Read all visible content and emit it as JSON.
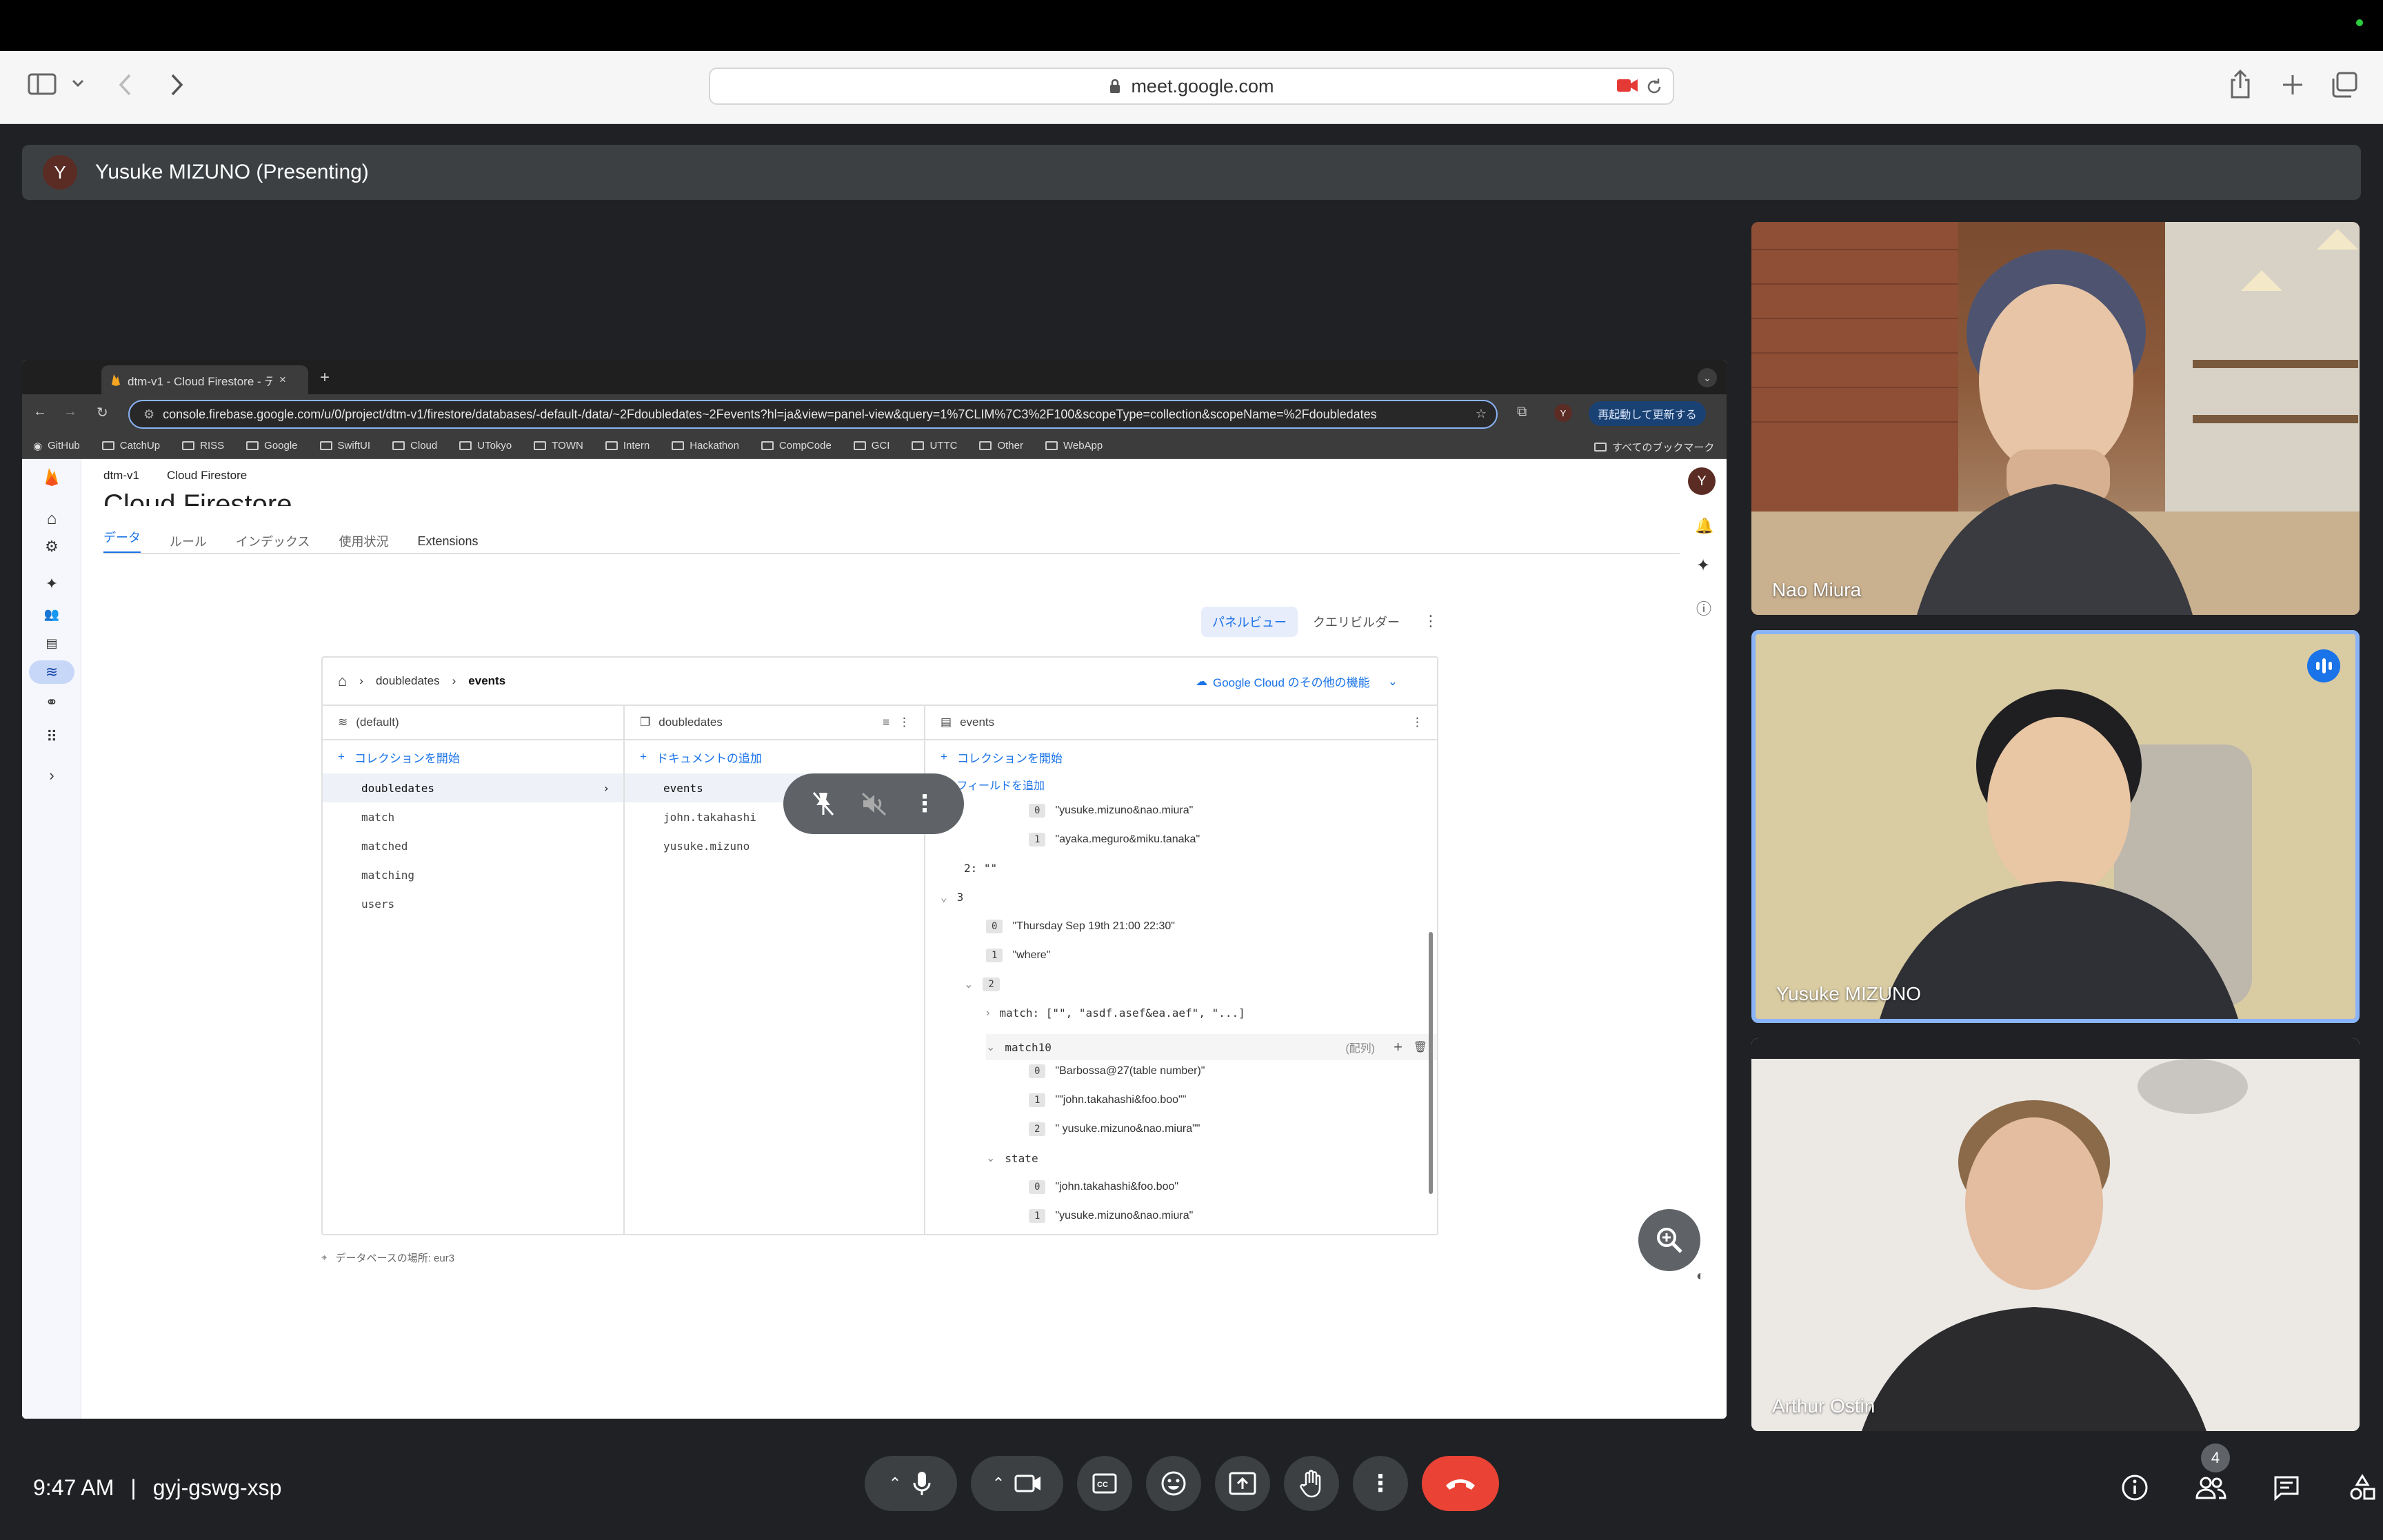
{
  "safari": {
    "address": "meet.google.com"
  },
  "meet": {
    "presenter_initial": "Y",
    "presenting_title": "Yusuke MIZUNO (Presenting)",
    "time": "9:47 AM",
    "separator": "|",
    "meeting_code": "gyj-gswg-xsp",
    "participants_count": "4",
    "accent": "#8ab4f8",
    "end_call_color": "#ea4335"
  },
  "shared_screen": {
    "tab_title": "dtm-v1 - Cloud Firestore - デ",
    "url": "console.firebase.google.com/u/0/project/dtm-v1/firestore/databases/-default-/data/~2Fdoubledates~2Fevents?hl=ja&view=panel-view&query=1%7CLIM%7C3%2F100&scopeType=collection&scopeName=%2Fdoubledates",
    "relaunch_label": "再起動して更新する",
    "profile_initial": "Y",
    "bookmarks": [
      "GitHub",
      "CatchUp",
      "RISS",
      "Google",
      "SwiftUI",
      "Cloud",
      "UTokyo",
      "TOWN",
      "Intern",
      "Hackathon",
      "CompCode",
      "GCI",
      "UTTC",
      "Other",
      "WebApp"
    ],
    "all_bookmarks": "すべてのブックマーク",
    "project": "dtm-v1",
    "product": "Cloud Firestore",
    "page_title": "Cloud Firestore",
    "tabs": [
      "データ",
      "ルール",
      "インデックス",
      "使用状況",
      "Extensions"
    ],
    "panel_view": "パネルビュー",
    "query_builder": "クエリビルダー",
    "breadcrumb": [
      "doubledates",
      "events"
    ],
    "gc_link": "Google Cloud のその他の機能",
    "col1": {
      "header": "(default)",
      "add": "コレクションを開始",
      "items": [
        "doubledates",
        "match",
        "matched",
        "matching",
        "users"
      ]
    },
    "col2": {
      "header": "doubledates",
      "add": "ドキュメントの追加",
      "items": [
        "events",
        "john.takahashi",
        "yusuke.mizuno"
      ]
    },
    "col3": {
      "header": "events",
      "add": "コレクションを開始",
      "add_field": "フィールドを追加"
    },
    "fields": {
      "f0_idx": "0",
      "f0": "\"yusuke.mizuno&nao.miura\"",
      "f1_idx": "1",
      "f1": "\"ayaka.meguro&miku.tanaka\"",
      "f2": "2: \"\"",
      "f3": "3",
      "f3_0_idx": "0",
      "f3_0": "\"Thursday Sep 19th 21:00 22:30\"",
      "f3_1_idx": "1",
      "f3_1": "\"where\"",
      "f3_2_idx": "2",
      "match": "match: [\"\", \"asdf.asef&ea.aef\", \"...]",
      "match10": "match10",
      "array_type": "(配列)",
      "m0_idx": "0",
      "m0": "\"Barbossa@27(table number)\"",
      "m1_idx": "1",
      "m1": "\"\"john.takahashi&foo.boo\"\"",
      "m2_idx": "2",
      "m2": "\" yusuke.mizuno&nao.miura\"\"",
      "state": "state",
      "s0_idx": "0",
      "s0": "\"john.takahashi&foo.boo\"",
      "s1_idx": "1",
      "s1": "\"yusuke.mizuno&nao.miura\""
    },
    "db_location": "データベースの場所: eur3"
  },
  "participants": [
    {
      "name": "Nao Miura"
    },
    {
      "name": "Yusuke MIZUNO",
      "speaking": true
    },
    {
      "name": "Arthur Ostin"
    }
  ]
}
